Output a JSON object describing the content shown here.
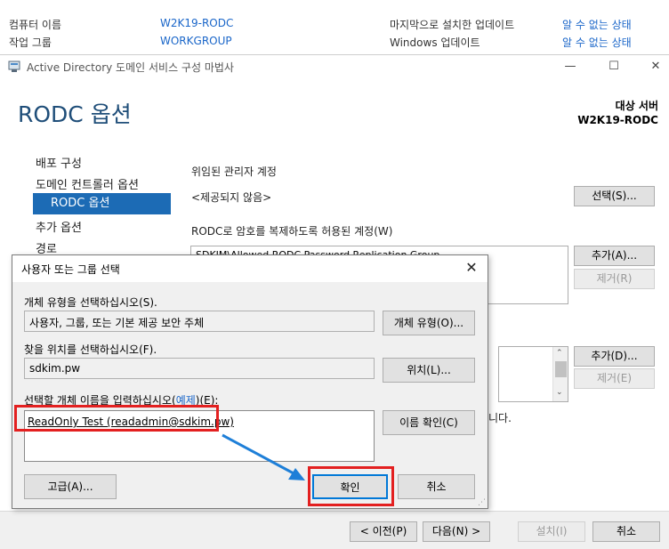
{
  "server_manager": {
    "rows": [
      {
        "label": "컴퓨터 이름",
        "value": "W2K19-RODC",
        "right_label": "마지막으로 설치한 업데이트",
        "right_value": "알 수 없는 상태"
      },
      {
        "label": "작업 그룹",
        "value": "WORKGROUP",
        "right_label": "Windows 업데이트",
        "right_value": "알 수 없는 상태"
      }
    ]
  },
  "wizard": {
    "title": "Active Directory 도메인 서비스 구성 마법사",
    "heading": "RODC 옵션",
    "target_label": "대상 서버",
    "target_server": "W2K19-RODC",
    "nav": [
      "배포 구성",
      "도메인 컨트롤러 옵션",
      "RODC 옵션",
      "추가 옵션",
      "경로"
    ],
    "delegated_admin_label": "위임된 관리자 계정",
    "delegated_admin_value": "<제공되지 않음>",
    "select_button": "선택(S)...",
    "allowed_label": "RODC로 암호를 복제하도록 허용된 계정(W)",
    "allowed_account": "SDKIM\\Allowed RODC Password Replication Group",
    "add_button_1": "추가(A)...",
    "remove_button_1": "제거(R)",
    "add_button_2": "추가(D)...",
    "remove_button_2": "제거(E)",
    "partial_text": "니다.",
    "back_button": "< 이전(P)",
    "next_button": "다음(N) >",
    "install_button": "설치(I)",
    "cancel_button": "취소"
  },
  "dialog": {
    "title": "사용자 또는 그룹 선택",
    "object_type_label": "개체 유형을 선택하십시오(S).",
    "object_type_value": "사용자, 그룹, 또는 기본 제공 보안 주체",
    "object_type_button": "개체 유형(O)...",
    "location_label": "찾을 위치를 선택하십시오(F).",
    "location_value": "sdkim.pw",
    "location_button": "위치(L)...",
    "names_label_prefix": "선택할 개체 이름을 입력하십시오(",
    "names_label_link": "예제",
    "names_label_suffix": ")(E):",
    "names_value": "ReadOnly Test (readadmin@sdkim.pw)",
    "check_names_button": "이름 확인(C)",
    "advanced_button": "고급(A)...",
    "ok_button": "확인",
    "cancel_button": "취소"
  },
  "annotations": {
    "highlight_color": "#e32020",
    "arrow_color": "#1e7fd8"
  }
}
